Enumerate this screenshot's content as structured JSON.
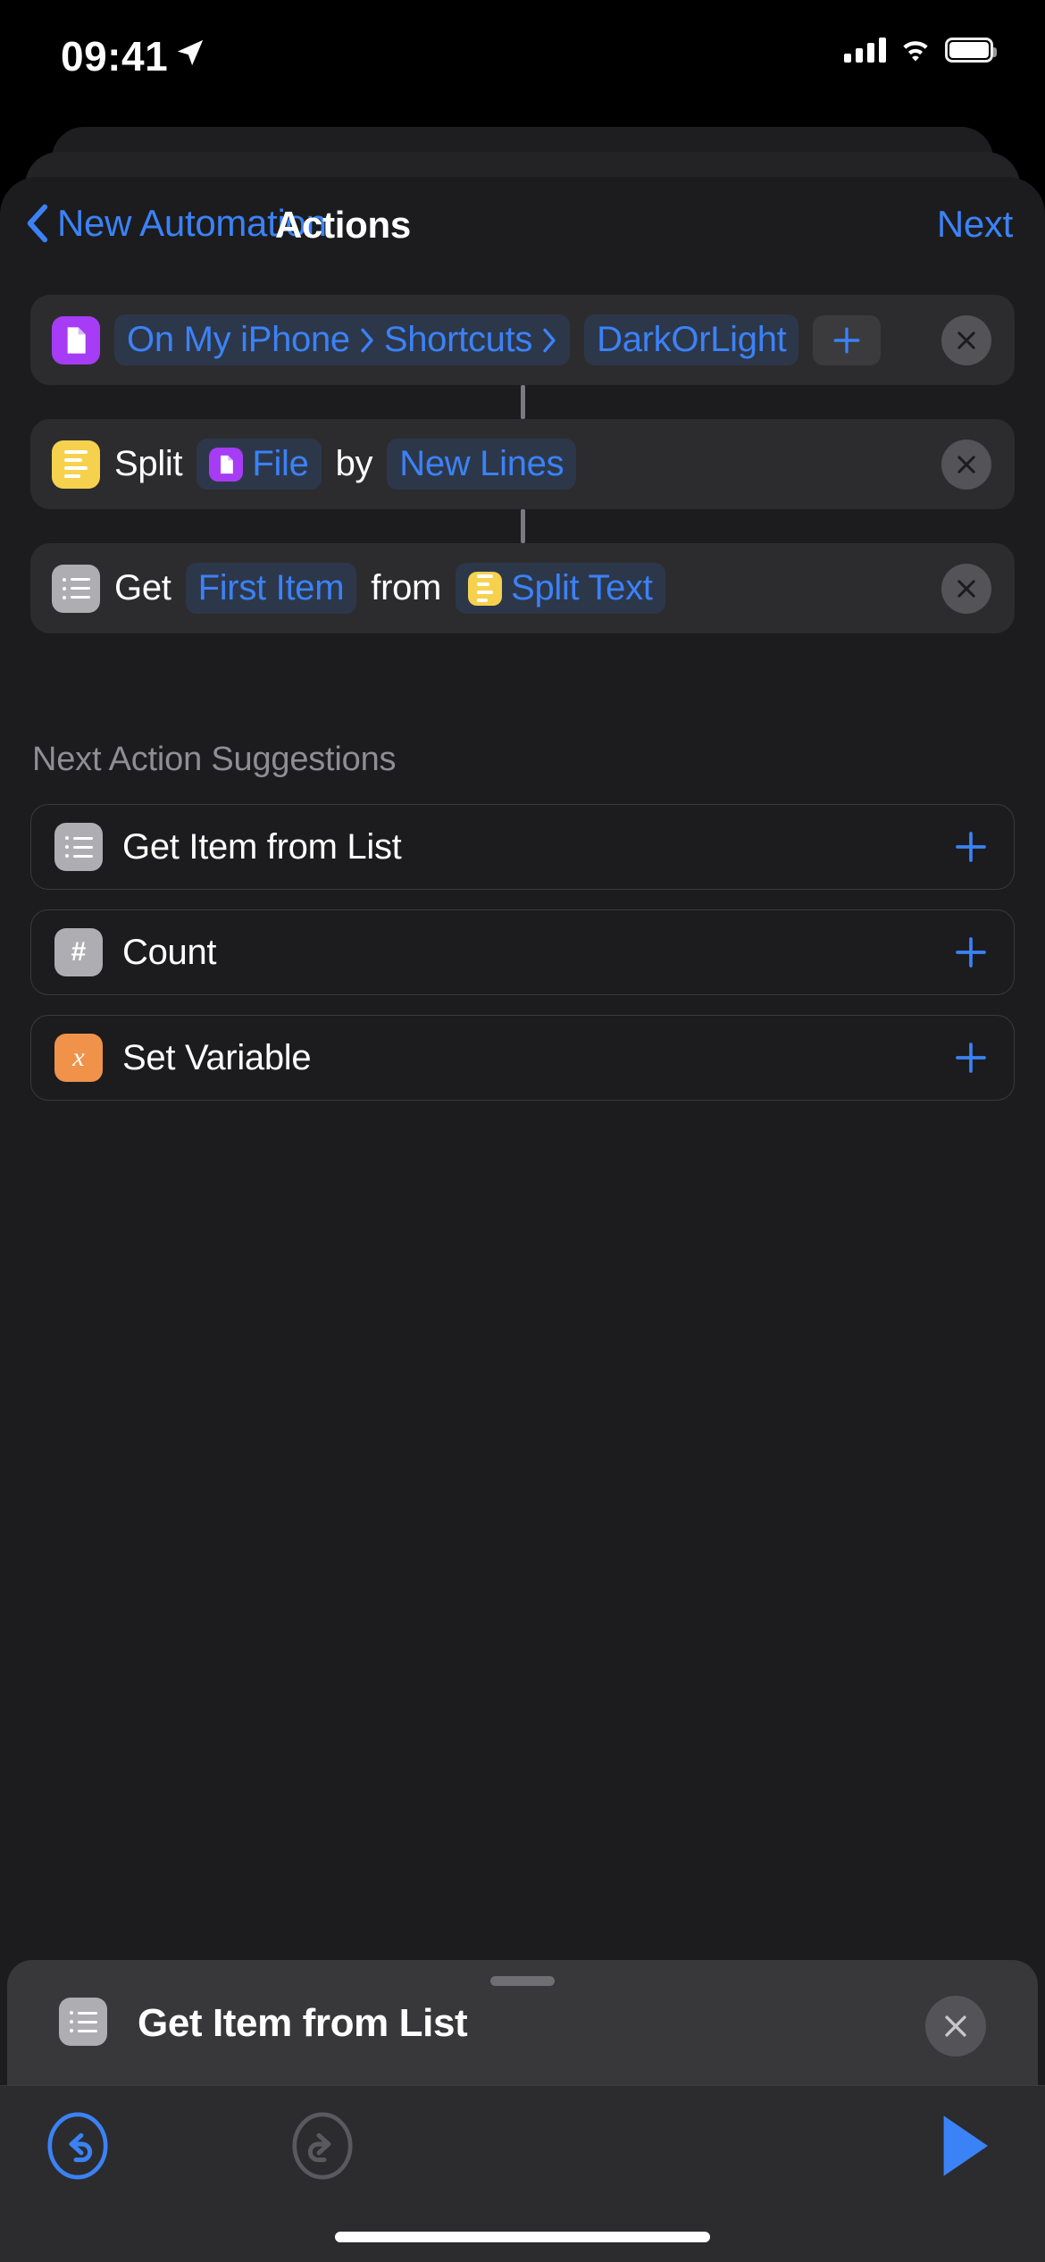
{
  "status_bar": {
    "time": "09:41",
    "location_icon": "location-arrow-icon",
    "cellular_icon": "cellular-signal-icon",
    "wifi_icon": "wifi-icon",
    "battery_icon": "battery-full-icon"
  },
  "nav": {
    "back_label": "New Automation",
    "back_icon": "chevron-left-icon",
    "title": "Actions",
    "next_label": "Next"
  },
  "actions": [
    {
      "icon": "file-document-icon",
      "icon_color": "#a63cf5",
      "parts": [
        {
          "kind": "token_path",
          "crumbs": [
            "On My iPhone",
            "Shortcuts"
          ],
          "trailing_chevron": true
        },
        {
          "kind": "token",
          "text": "DarkOrLight"
        },
        {
          "kind": "token_plus",
          "icon": "plus-icon"
        }
      ],
      "close_icon": "close-x-icon"
    },
    {
      "icon": "text-lines-icon",
      "icon_color": "#f5d14e",
      "parts": [
        {
          "kind": "word",
          "text": "Split"
        },
        {
          "kind": "token_with_icon",
          "text": "File",
          "icon": "file-document-icon",
          "icon_color": "#a63cf5"
        },
        {
          "kind": "word",
          "text": "by"
        },
        {
          "kind": "token",
          "text": "New Lines"
        }
      ],
      "close_icon": "close-x-icon"
    },
    {
      "icon": "bulleted-list-icon",
      "icon_color": "#aeaeb2",
      "parts": [
        {
          "kind": "word",
          "text": "Get"
        },
        {
          "kind": "token",
          "text": "First Item"
        },
        {
          "kind": "word",
          "text": "from"
        },
        {
          "kind": "token_with_icon",
          "text": "Split Text",
          "icon": "text-lines-icon",
          "icon_color": "#f5d14e"
        }
      ],
      "close_icon": "close-x-icon"
    }
  ],
  "suggestions": {
    "title": "Next Action Suggestions",
    "items": [
      {
        "label": "Get Item from List",
        "icon": "bulleted-list-icon",
        "icon_color": "#aeaeb2",
        "add_icon": "plus-icon"
      },
      {
        "label": "Count",
        "icon": "hash-icon",
        "icon_color": "#aeaeb2",
        "add_icon": "plus-icon"
      },
      {
        "label": "Set Variable",
        "icon": "variable-x-icon",
        "icon_color": "#f0924a",
        "add_icon": "plus-icon"
      }
    ]
  },
  "bottom_sheet": {
    "grabber": "drag-handle",
    "icon": "bulleted-list-icon",
    "icon_color": "#aeaeb2",
    "title": "Get Item from List",
    "close_icon": "close-x-icon"
  },
  "toolbar": {
    "undo_icon": "undo-arrow-icon",
    "redo_icon": "redo-arrow-icon",
    "play_icon": "play-triangle-icon"
  },
  "colors": {
    "accent_blue": "#3b82f6",
    "card_bg": "#2c2c2e",
    "sheet_bg": "#1c1c1e",
    "secondary_text": "#8e8e93",
    "purple": "#a63cf5",
    "yellow": "#f5d14e",
    "gray_icon": "#aeaeb2",
    "orange": "#f0924a"
  }
}
